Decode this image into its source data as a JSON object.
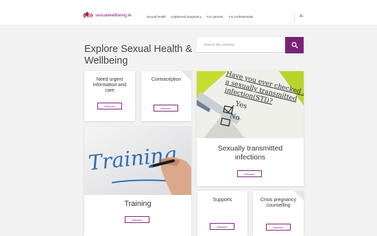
{
  "header": {
    "logo_text": "sexualwellbeing.ie",
    "nav": [
      "Sexual health",
      "Unplanned pregnancy",
      "For parents",
      "For professionals"
    ]
  },
  "hero": {
    "title": "Explore Sexual Health & Wellbeing"
  },
  "search": {
    "placeholder": "Search the website"
  },
  "cards": {
    "urgent": {
      "title": "Need urgent information and care",
      "button": "Discover"
    },
    "contraception": {
      "title": "Contraception",
      "button": "Discover"
    },
    "sti": {
      "title": "Sexually transmitted infections",
      "button": "Discover",
      "image_text": [
        "Have you ever checked for",
        "a sexually transmitted",
        "infection(STI)?",
        "Yes",
        "No"
      ]
    },
    "training": {
      "title": "Training",
      "button": "Discover",
      "image_text": "Training"
    },
    "supports": {
      "title": "Supports",
      "button": "Discover"
    },
    "crisis": {
      "title": "Crisis pregnancy counselling",
      "button": "Discover"
    }
  },
  "colors": {
    "brand": "#7a2278",
    "background": "#f2f2f2"
  }
}
